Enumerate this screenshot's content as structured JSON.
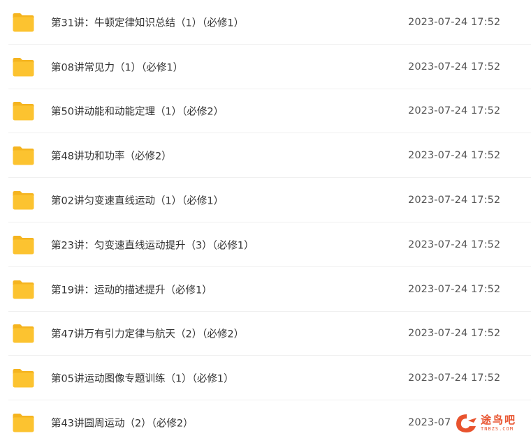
{
  "files": [
    {
      "name": "第31讲：牛顿定律知识总结（1）（必修1）",
      "modified": "2023-07-24 17:52",
      "icon": "folder-icon"
    },
    {
      "name": "第08讲常见力（1）（必修1）",
      "modified": "2023-07-24 17:52",
      "icon": "folder-icon"
    },
    {
      "name": "第50讲动能和动能定理（1）（必修2）",
      "modified": "2023-07-24 17:52",
      "icon": "folder-icon"
    },
    {
      "name": "第48讲功和功率（必修2）",
      "modified": "2023-07-24 17:52",
      "icon": "folder-icon"
    },
    {
      "name": "第02讲匀变速直线运动（1）（必修1）",
      "modified": "2023-07-24 17:52",
      "icon": "folder-icon"
    },
    {
      "name": "第23讲：匀变速直线运动提升（3）（必修1）",
      "modified": "2023-07-24 17:52",
      "icon": "folder-icon"
    },
    {
      "name": "第19讲：运动的描述提升（必修1）",
      "modified": "2023-07-24 17:52",
      "icon": "folder-icon"
    },
    {
      "name": "第47讲万有引力定律与航天（2）（必修2）",
      "modified": "2023-07-24 17:52",
      "icon": "folder-icon"
    },
    {
      "name": "第05讲运动图像专题训练（1）（必修1）",
      "modified": "2023-07-24 17:52",
      "icon": "folder-icon"
    },
    {
      "name": "第43讲圆周运动（2）（必修2）",
      "modified": "2023-07-",
      "icon": "folder-icon"
    }
  ],
  "watermark": {
    "text": "途鸟吧",
    "subtext": "TNBZS.COM",
    "color": "#e8532e"
  },
  "colors": {
    "folder_body": "#fcc330",
    "folder_back": "#f5b41f",
    "divider": "#f0f0f0"
  }
}
